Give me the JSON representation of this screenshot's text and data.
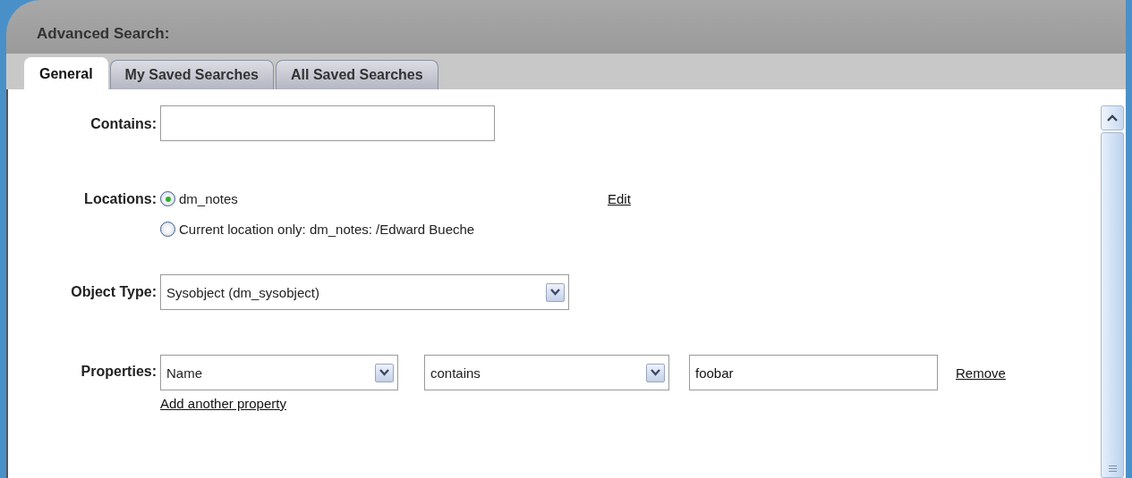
{
  "window": {
    "title": "Advanced Search:"
  },
  "tabs": [
    {
      "label": "General",
      "selected": true
    },
    {
      "label": "My Saved Searches",
      "selected": false
    },
    {
      "label": "All Saved Searches",
      "selected": false
    }
  ],
  "contains": {
    "label": "Contains:"
  },
  "locations": {
    "label": "Locations:",
    "edit_link": "Edit",
    "options": [
      {
        "label": "dm_notes",
        "selected": true
      },
      {
        "label": "Current location only: dm_notes: /Edward Bueche",
        "selected": false
      }
    ]
  },
  "object_type": {
    "label": "Object Type:",
    "value": "Sysobject (dm_sysobject)"
  },
  "properties": {
    "label": "Properties:",
    "rows": [
      {
        "field": "Name",
        "operator": "contains",
        "value": "foobar",
        "remove_link": "Remove"
      }
    ],
    "add_link": "Add another property"
  }
}
